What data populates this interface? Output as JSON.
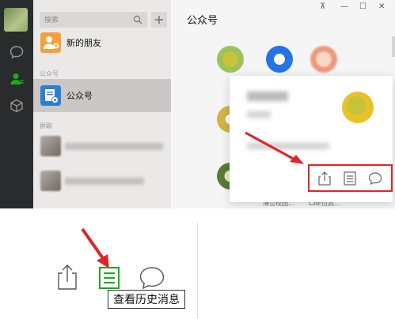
{
  "search": {
    "placeholder": "搜索"
  },
  "list": {
    "new_friends": "新的朋友",
    "section_official": "公众号",
    "official_item": "公众号",
    "section_groups": "群聊"
  },
  "main": {
    "title": "公众号",
    "window_controls": {
      "pin": "⊼",
      "minimize": "—",
      "maximize": "☐",
      "close": "✕"
    },
    "accounts": [
      {
        "caption": "博世校园..."
      },
      {
        "caption": "CAE仿真..."
      }
    ]
  },
  "tooltip": {
    "label": "查看历史消息"
  },
  "colors": {
    "accent_red": "#e0242a",
    "wechat_green": "#1aad19",
    "nav_bg": "#2a2b2d"
  }
}
